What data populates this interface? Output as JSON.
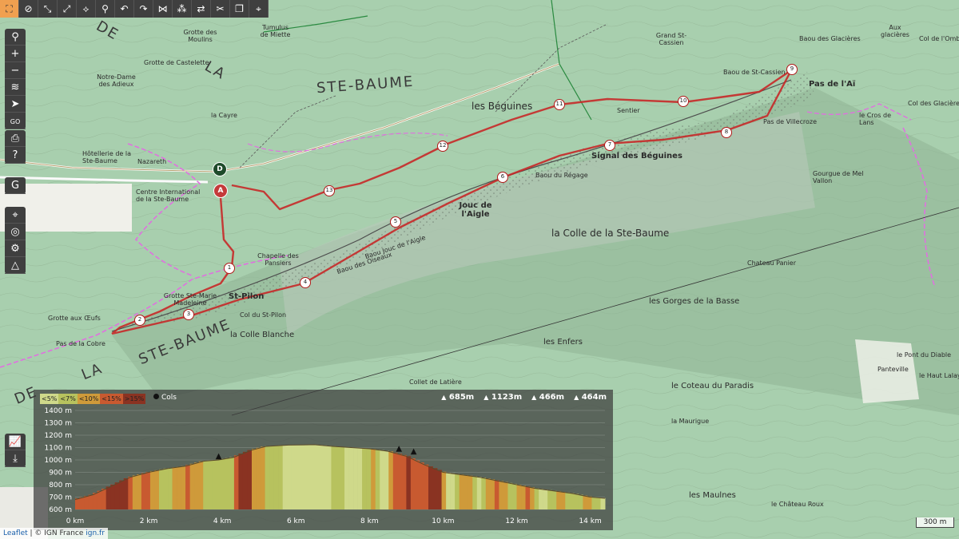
{
  "toolbar": {
    "buttons": [
      {
        "icon": "fullscreen-icon",
        "glyph": "⛶"
      },
      {
        "icon": "hide-icon",
        "glyph": "⊘"
      },
      {
        "icon": "route-icon",
        "glyph": "⤡"
      },
      {
        "icon": "route-edit-icon",
        "glyph": "⤢"
      },
      {
        "icon": "route-split-icon",
        "glyph": "⟡"
      },
      {
        "icon": "bike-icon",
        "glyph": "⚲"
      },
      {
        "icon": "undo-icon",
        "glyph": "↶"
      },
      {
        "icon": "redo-icon",
        "glyph": "↷"
      },
      {
        "icon": "join-icon",
        "glyph": "⋈"
      },
      {
        "icon": "nodes-icon",
        "glyph": "⁂"
      },
      {
        "icon": "reverse-icon",
        "glyph": "⇄"
      },
      {
        "icon": "cut-icon",
        "glyph": "✂"
      },
      {
        "icon": "copy-icon",
        "glyph": "❐"
      },
      {
        "icon": "marker-icon",
        "glyph": "⌖"
      }
    ]
  },
  "leftbar": {
    "group1": [
      {
        "icon": "search-icon",
        "glyph": "⚲"
      },
      {
        "icon": "zoom-in-icon",
        "glyph": "+"
      },
      {
        "icon": "zoom-out-icon",
        "glyph": "−"
      },
      {
        "icon": "layers-icon",
        "glyph": "≋"
      },
      {
        "icon": "locate-icon",
        "glyph": "➤"
      },
      {
        "icon": "goto-icon",
        "glyph": "GO"
      }
    ],
    "group2": [
      {
        "icon": "print-icon",
        "glyph": "⎙"
      },
      {
        "icon": "help-icon",
        "glyph": "?"
      }
    ],
    "group3": [
      {
        "icon": "google-icon",
        "glyph": "G"
      }
    ],
    "group4": [
      {
        "icon": "target-icon",
        "glyph": "⌖"
      },
      {
        "icon": "globe-icon",
        "glyph": "◎"
      },
      {
        "icon": "network-icon",
        "glyph": "⚙"
      },
      {
        "icon": "mountain-icon",
        "glyph": "△"
      }
    ],
    "group5": [
      {
        "icon": "elevation-chart-icon",
        "glyph": "📈"
      },
      {
        "icon": "download-icon",
        "glyph": "⤓"
      }
    ]
  },
  "map": {
    "places": [
      {
        "text": "STE-BAUME",
        "cls": "xl"
      },
      {
        "text": "LA",
        "cls": "xl"
      },
      {
        "text": "STE-BAUME",
        "cls": "xl"
      },
      {
        "text": "DE",
        "cls": "xl"
      },
      {
        "text": "DE",
        "cls": "xl"
      },
      {
        "text": "LA",
        "cls": "xl"
      },
      {
        "text": "les Béguines",
        "cls": "lg"
      },
      {
        "text": "la Colle de la Ste-Baume",
        "cls": "lg"
      },
      {
        "text": "Signal des Béguines",
        "cls": "md b"
      },
      {
        "text": "Jouc de l'Aigle",
        "cls": "md b"
      },
      {
        "text": "Pas de l'Aï",
        "cls": "md b"
      },
      {
        "text": "Hôtellerie de la Ste-Baume",
        "cls": "sm"
      },
      {
        "text": "Centre International de la Ste-Baume",
        "cls": "sm"
      },
      {
        "text": "Chapelle des Pansiers",
        "cls": "sm"
      },
      {
        "text": "Grotte Ste-Marie Madeleine",
        "cls": "sm"
      },
      {
        "text": "St-Pilon",
        "cls": "md b"
      },
      {
        "text": "Col du St-Pilon",
        "cls": "sm"
      },
      {
        "text": "la Colle Blanche",
        "cls": "md"
      },
      {
        "text": "les Gorges de la Basse",
        "cls": "md"
      },
      {
        "text": "les Enfers",
        "cls": "md"
      },
      {
        "text": "le Coteau du Paradis",
        "cls": "md"
      },
      {
        "text": "Collet de Latière",
        "cls": "sm"
      },
      {
        "text": "la Cayre",
        "cls": "sm"
      },
      {
        "text": "Nazareth",
        "cls": "sm"
      },
      {
        "text": "Baou du Régage",
        "cls": "sm"
      },
      {
        "text": "Baou des Oiseaux",
        "cls": "sm"
      },
      {
        "text": "Pas de Villecroze",
        "cls": "sm"
      },
      {
        "text": "Baou des Glacières",
        "cls": "sm"
      },
      {
        "text": "Baou de St-Cassien",
        "cls": "sm"
      },
      {
        "text": "Grotte de Castelette",
        "cls": "sm"
      },
      {
        "text": "Notre-Dame des Adieux",
        "cls": "sm"
      },
      {
        "text": "Grotte des Moulins",
        "cls": "sm"
      },
      {
        "text": "Tumulus de Miette",
        "cls": "sm"
      },
      {
        "text": "Grand St-Cassien",
        "cls": "sm"
      },
      {
        "text": "Sentier",
        "cls": "sm"
      },
      {
        "text": "Chateau Panier",
        "cls": "sm"
      },
      {
        "text": "Gourgue de Mel Vallon",
        "cls": "sm"
      },
      {
        "text": "Panteville",
        "cls": "sm"
      },
      {
        "text": "le Pont du Diable",
        "cls": "sm"
      },
      {
        "text": "le Haut Lalay",
        "cls": "sm"
      },
      {
        "text": "les Maulnes",
        "cls": "md"
      },
      {
        "text": "le Château Roux",
        "cls": "sm"
      },
      {
        "text": "la Maurigue",
        "cls": "sm"
      },
      {
        "text": "Col des Glacières",
        "cls": "sm"
      },
      {
        "text": "Aux glacières",
        "cls": "sm"
      },
      {
        "text": "le Cros de Lans",
        "cls": "sm"
      },
      {
        "text": "Grotte aux Œufs",
        "cls": "sm"
      },
      {
        "text": "Pas de la Cobre",
        "cls": "sm"
      },
      {
        "text": "Baou Jouc de l'Aigle",
        "cls": "sm"
      },
      {
        "text": "Col de l'Ombre",
        "cls": "sm"
      }
    ],
    "waypoints": [
      "1",
      "2",
      "3",
      "4",
      "5",
      "6",
      "7",
      "8",
      "9",
      "10",
      "11",
      "12",
      "13"
    ],
    "start_label": "D",
    "end_label": "A"
  },
  "elevation": {
    "legend": [
      {
        "label": "<5%",
        "color": "#cfd98a"
      },
      {
        "label": "<7%",
        "color": "#b7c25e"
      },
      {
        "label": "<10%",
        "color": "#cf9a3a"
      },
      {
        "label": "<15%",
        "color": "#c85a30"
      },
      {
        "label": ">15%",
        "color": "#8a3322"
      }
    ],
    "cols_label": "Cols",
    "passes": [
      "685m",
      "1123m",
      "466m",
      "464m"
    ],
    "y_ticks": [
      "1400 m",
      "1300 m",
      "1200 m",
      "1100 m",
      "1000 m",
      "900 m",
      "800 m",
      "700 m",
      "600 m"
    ],
    "x_ticks": [
      "0 km",
      "2 km",
      "4 km",
      "6 km",
      "8 km",
      "10 km",
      "12 km",
      "14 km"
    ]
  },
  "chart_data": {
    "type": "area",
    "title": "",
    "xlabel": "",
    "ylabel": "",
    "x_unit": "km",
    "y_unit": "m",
    "xlim": [
      0,
      14.4
    ],
    "ylim": [
      600,
      1400
    ],
    "x": [
      0,
      0.5,
      1.0,
      1.5,
      2.0,
      2.5,
      3.0,
      3.5,
      3.9,
      4.3,
      4.8,
      5.2,
      5.8,
      6.5,
      7.0,
      7.5,
      8.0,
      8.5,
      9.0,
      9.5,
      10.0,
      10.5,
      11.0,
      11.5,
      12.0,
      12.5,
      13.0,
      13.5,
      14.0,
      14.4
    ],
    "values": [
      680,
      720,
      790,
      860,
      900,
      930,
      950,
      990,
      1000,
      1020,
      1080,
      1110,
      1120,
      1123,
      1110,
      1100,
      1090,
      1070,
      1030,
      960,
      900,
      880,
      860,
      830,
      800,
      770,
      750,
      730,
      700,
      690
    ],
    "slope_colors": [
      "<5%",
      "<7%",
      "<10%",
      "<15%",
      ">15%"
    ]
  },
  "attribution": {
    "leaflet": "Leaflet",
    "sep": " | © IGN France ",
    "ign": "ign.fr"
  },
  "scale": "300 m"
}
